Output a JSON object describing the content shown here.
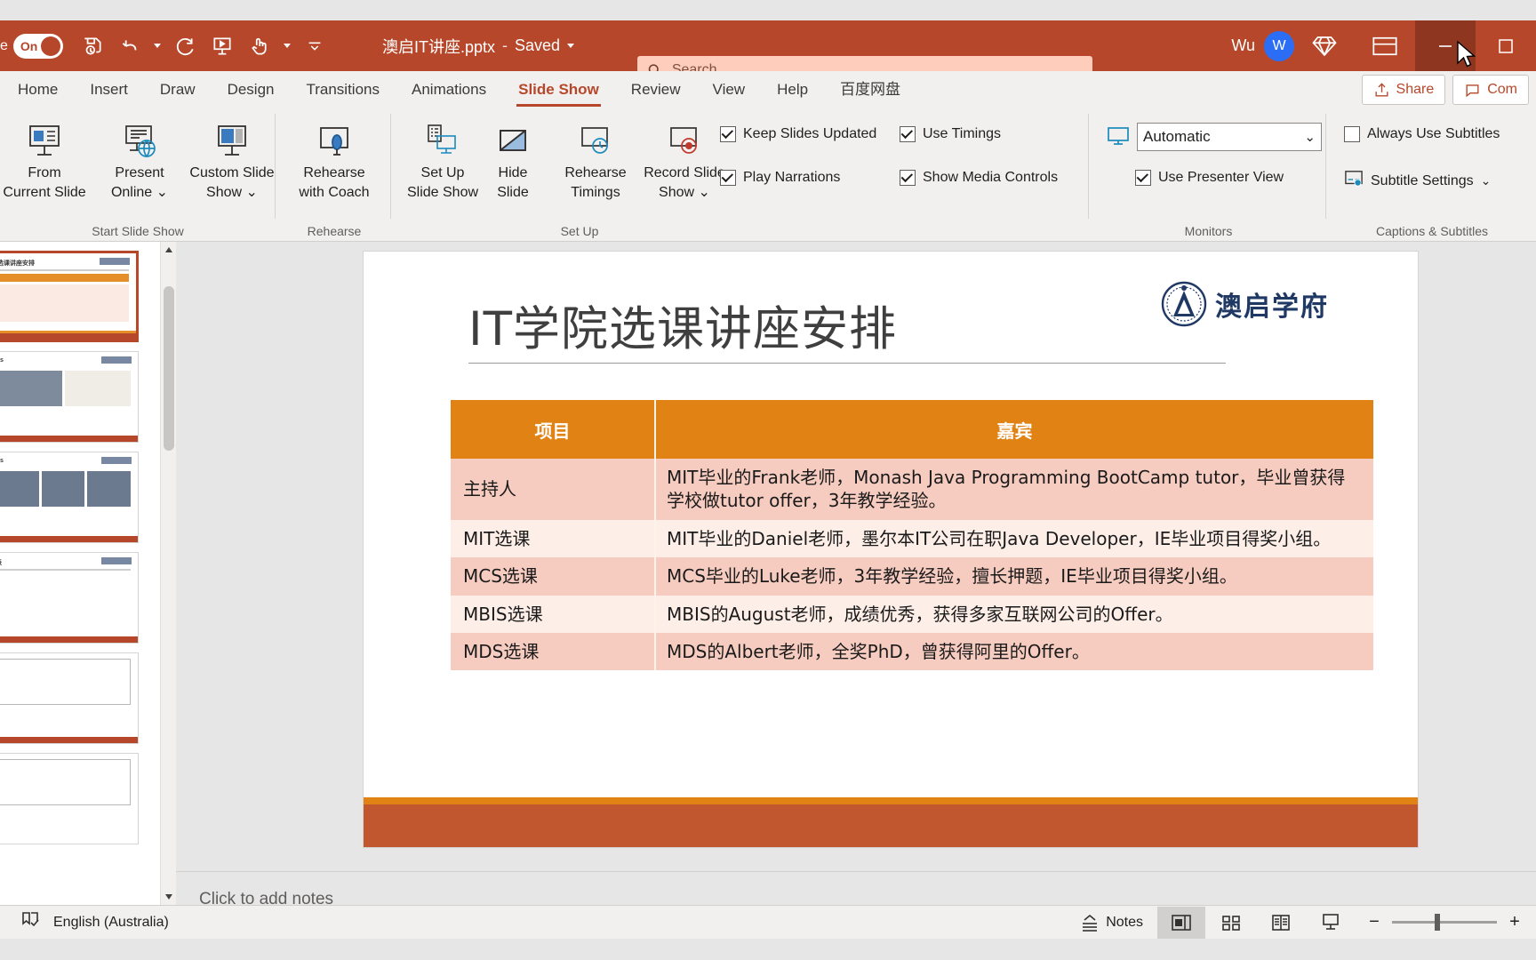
{
  "titlebar": {
    "autosave_label": "e",
    "autosave_state": "On",
    "doc_title": "澳启IT讲座.pptx",
    "separator": "-",
    "saved_label": "Saved",
    "user_name": "Wu",
    "avatar_initial": "W",
    "quick_access": [
      "save-icon",
      "undo-icon",
      "redo-icon",
      "start-slideshow-icon",
      "touch-mode-icon",
      "customize-qat-icon"
    ]
  },
  "search": {
    "placeholder": "Search",
    "value": "",
    "icon": "search-icon"
  },
  "tabs": [
    {
      "label": "Home",
      "active": false
    },
    {
      "label": "Insert",
      "active": false
    },
    {
      "label": "Draw",
      "active": false
    },
    {
      "label": "Design",
      "active": false
    },
    {
      "label": "Transitions",
      "active": false
    },
    {
      "label": "Animations",
      "active": false
    },
    {
      "label": "Slide Show",
      "active": true
    },
    {
      "label": "Review",
      "active": false
    },
    {
      "label": "View",
      "active": false
    },
    {
      "label": "Help",
      "active": false
    },
    {
      "label": "百度网盘",
      "active": false
    }
  ],
  "share": {
    "share_label": "Share",
    "comments_label": "Com"
  },
  "ribbon": {
    "groups": [
      {
        "label": "Start Slide Show"
      },
      {
        "label": "Rehearse"
      },
      {
        "label": "Set Up"
      },
      {
        "label": "Monitors"
      },
      {
        "label": "Captions & Subtitles"
      }
    ],
    "from_current_slide": {
      "line1": "From",
      "line2": "Current Slide"
    },
    "present_online": {
      "line1": "Present",
      "line2": "Online"
    },
    "custom_slide_show": {
      "line1": "Custom Slide",
      "line2": "Show"
    },
    "rehearse_with_coach": {
      "line1": "Rehearse",
      "line2": "with Coach"
    },
    "set_up_slide_show": {
      "line1": "Set Up",
      "line2": "Slide Show"
    },
    "hide_slide": {
      "line1": "Hide",
      "line2": "Slide"
    },
    "rehearse_timings": {
      "line1": "Rehearse",
      "line2": "Timings"
    },
    "record_slide_show": {
      "line1": "Record Slide",
      "line2": "Show"
    },
    "checkboxes": [
      {
        "label": "Keep Slides Updated",
        "checked": true
      },
      {
        "label": "Use Timings",
        "checked": true
      },
      {
        "label": "Play Narrations",
        "checked": true
      },
      {
        "label": "Show Media Controls",
        "checked": true
      },
      {
        "label": "Use Presenter View",
        "checked": true
      },
      {
        "label": "Always Use Subtitles",
        "checked": false
      }
    ],
    "monitor_select": {
      "value": "Automatic"
    },
    "subtitle_settings": {
      "label": "Subtitle Settings"
    }
  },
  "slide": {
    "title": "IT学院选课讲座安排",
    "logo_text": "澳启学府",
    "table": {
      "headers": [
        "项目",
        "嘉宾"
      ],
      "rows": [
        {
          "item": "主持人",
          "guest": "MIT毕业的Frank老师，Monash Java Programming BootCamp tutor，毕业曾获得学校做tutor offer，3年教学经验。"
        },
        {
          "item": "MIT选课",
          "guest": "MIT毕业的Daniel老师，墨尔本IT公司在职Java Developer，IE毕业项目得奖小组。"
        },
        {
          "item": "MCS选课",
          "guest": "MCS毕业的Luke老师，3年教学经验，擅长押题，IE毕业项目得奖小组。"
        },
        {
          "item": "MBIS选课",
          "guest": "MBIS的August老师，成绩优秀，获得多家互联网公司的Offer。"
        },
        {
          "item": "MDS选课",
          "guest": "MDS的Albert老师，全奖PhD，曾获得阿里的Offer。"
        }
      ]
    }
  },
  "notes": {
    "placeholder": "Click to add notes"
  },
  "statusbar": {
    "language": "English (Australia)",
    "notes_label": "Notes",
    "views": [
      "normal-view",
      "slide-sorter-view",
      "reading-view",
      "slide-show-view"
    ],
    "zoom_minus": "−",
    "zoom_plus": "+"
  },
  "colors": {
    "accent": "#b7472a",
    "table_header": "#e08214",
    "row_odd": "#f7ccc0",
    "row_even": "#fdeee8",
    "footbar": "#c0572e",
    "logo_blue": "#1f3864",
    "avatar_blue": "#2b6ef5"
  }
}
